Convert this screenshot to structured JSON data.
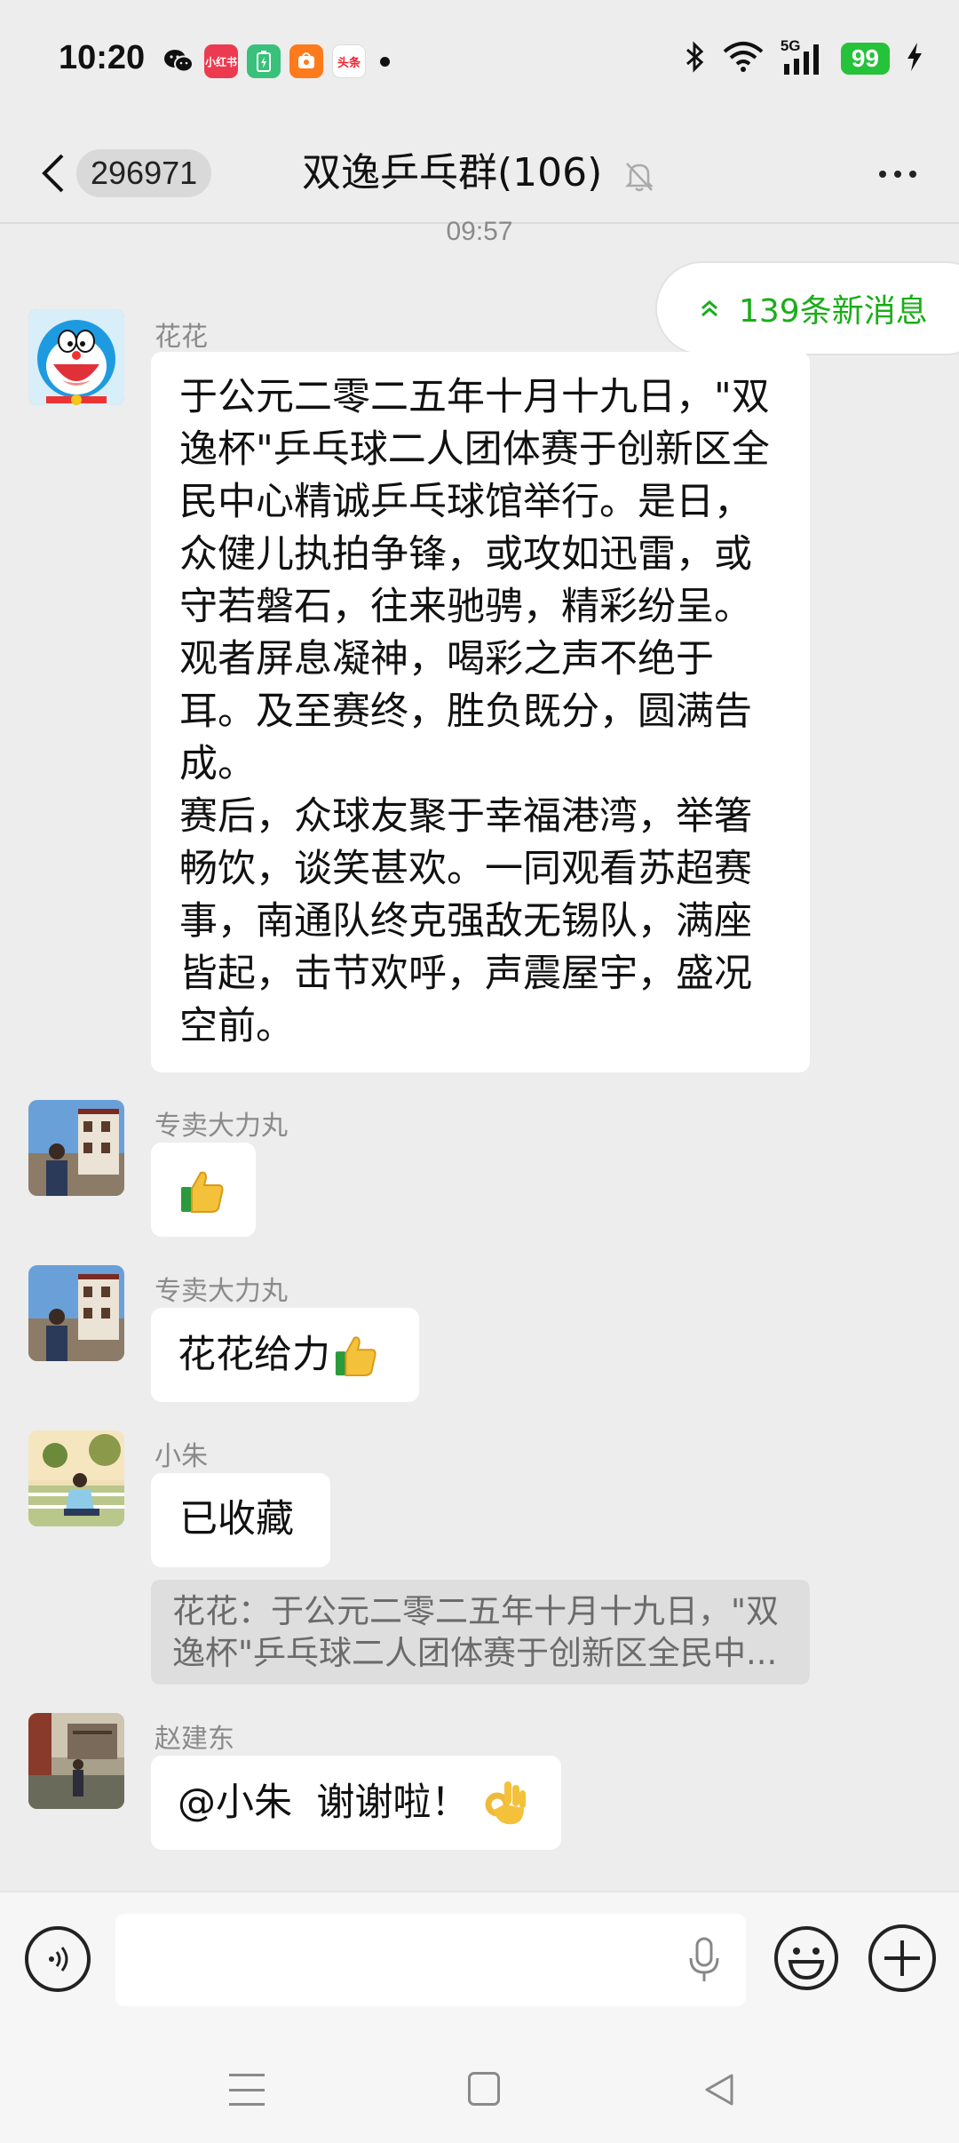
{
  "status_bar": {
    "time": "10:20",
    "notifications": [
      {
        "icon": "wechat-icon",
        "label": ""
      },
      {
        "icon": "xiaohongshu-icon",
        "label": "小红书"
      },
      {
        "icon": "battery-app-icon",
        "label": ""
      },
      {
        "icon": "taobao-icon",
        "label": ""
      },
      {
        "icon": "toutiao-icon",
        "label": "头条"
      }
    ],
    "network": "5G",
    "battery": "99"
  },
  "header": {
    "unread_count": "296971",
    "title": "双逸乒乓群(106)"
  },
  "timestamp": "09:57",
  "new_messages": "139条新消息",
  "messages": [
    {
      "sender": "花花",
      "text": "于公元二零二五年十月十九日，\"双逸杯\"乒乓球二人团体赛于创新区全民中心精诚乒乓球馆举行。是日，众健儿执拍争锋，或攻如迅雷，或守若磐石，往来驰骋，精彩纷呈。观者屏息凝神，喝彩之声不绝于耳。及至赛终，胜负既分，圆满告成。",
      "text2": "赛后，众球友聚于幸福港湾，举箸畅饮，谈笑甚欢。一同观看苏超赛事，南通队终克强敌无锡队，满座皆起，击节欢呼，声震屋宇，盛况空前。"
    },
    {
      "sender": "专卖大力丸",
      "text": "",
      "emoji": "thumbs-up"
    },
    {
      "sender": "专卖大力丸",
      "text": "花花给力",
      "emoji": "thumbs-up"
    },
    {
      "sender": "小朱",
      "text": "已收藏",
      "quote": "花花：于公元二零二五年十月十九日，\"双逸杯\"乒乓球二人团体赛于创新区全民中..."
    },
    {
      "sender": "赵建东",
      "text": "@小朱  谢谢啦！",
      "emoji": "ok-hand"
    }
  ],
  "input": {
    "placeholder": "",
    "value": ""
  },
  "colors": {
    "background": "#ededed",
    "bubble": "#ffffff",
    "accent_green": "#1aad19",
    "battery_green": "#25c23a"
  }
}
